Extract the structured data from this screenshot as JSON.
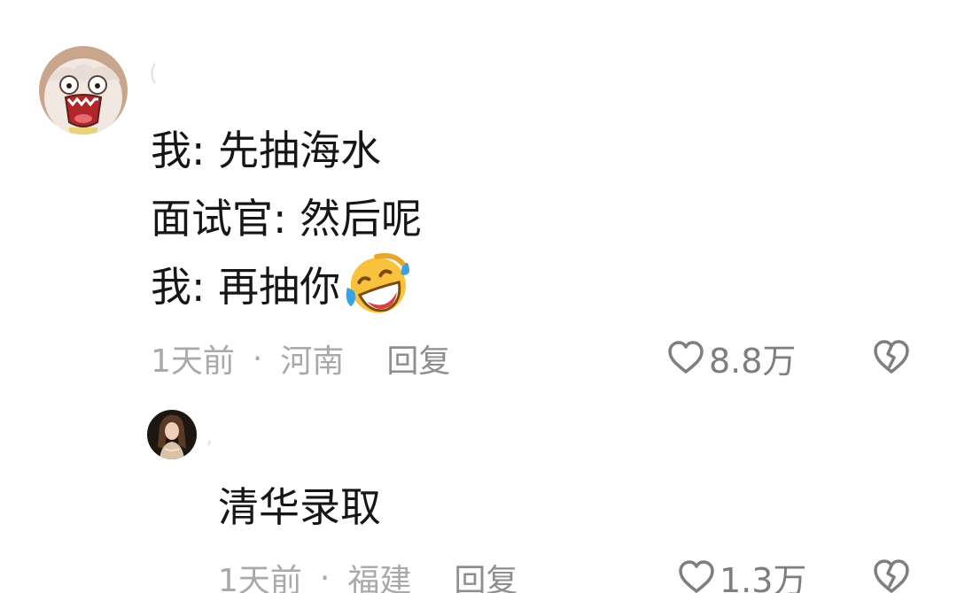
{
  "comment": {
    "avatar_icon": "cartoon-screaming-avatar",
    "lines": [
      "我: 先抽海水",
      "面试官: 然后呢",
      "我: 再抽你"
    ],
    "emoji": "laughing-crying-emoji",
    "time": "1天前",
    "separator": "·",
    "location": "河南",
    "reply_label": "回复",
    "like_count": "8.8万"
  },
  "reply": {
    "avatar_icon": "woman-portrait-avatar",
    "text": "清华录取",
    "time": "1天前",
    "separator": "·",
    "location": "福建",
    "reply_label": "回复",
    "like_count": "1.3万"
  },
  "colors": {
    "text": "#161616",
    "meta": "#a9a9a9",
    "icon": "#7e7e7e",
    "emoji_yellow": "#F9C23C",
    "emoji_tear": "#3AA0E8"
  }
}
